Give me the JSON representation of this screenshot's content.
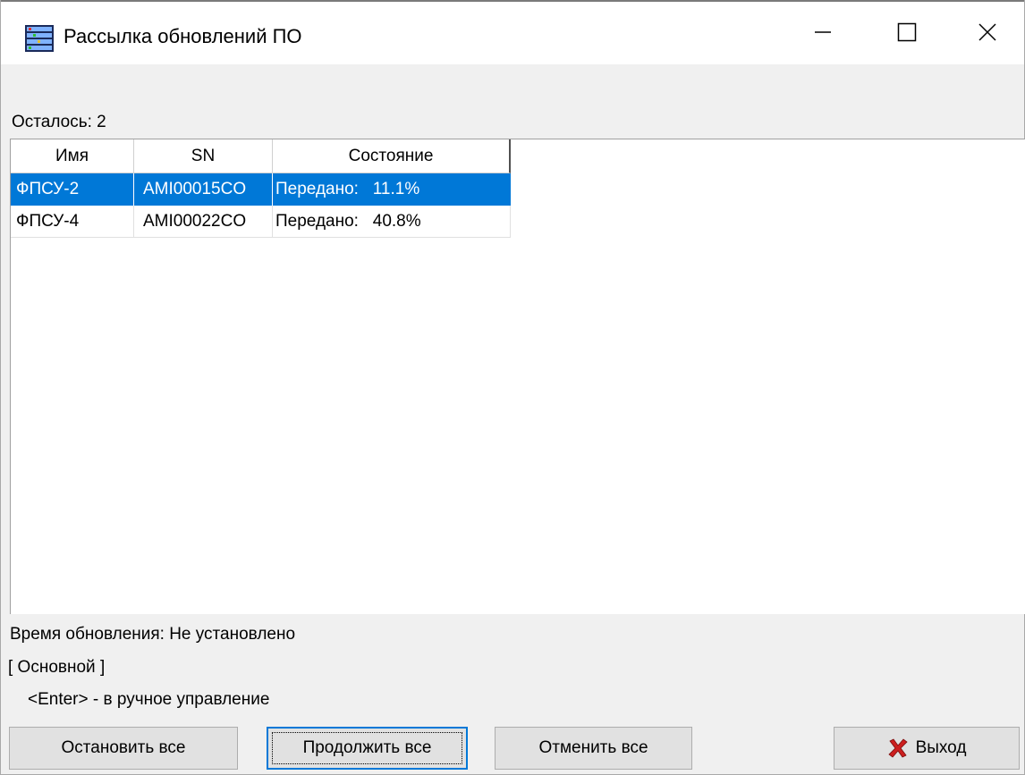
{
  "window": {
    "title": "Рассылка обновлений ПО",
    "icon": "server-rack-icon",
    "controls": [
      "minimize-icon",
      "maximize-icon",
      "close-icon"
    ]
  },
  "remaining": "Осталось: 2",
  "table": {
    "columns": [
      "Имя",
      "SN",
      "Состояние"
    ],
    "rows": [
      {
        "name": "ФПСУ-2",
        "sn": "AMI00015CO",
        "status": "Передано:   11.1%",
        "selected": true
      },
      {
        "name": "ФПСУ-4",
        "sn": "AMI00022CO",
        "status": "Передано:   40.8%",
        "selected": false
      }
    ]
  },
  "status": {
    "update_time": "Время обновления: Не установлено",
    "mode": "[ Основной ]",
    "hint": "<Enter> - в ручное управление"
  },
  "buttons": {
    "stop_all": "Остановить все",
    "continue_all": "Продолжить все",
    "cancel_all": "Отменить все",
    "exit": "Выход",
    "exit_icon": "red-x-icon"
  },
  "colors": {
    "selection": "#0078d7",
    "exit_icon": "#cc1f1f"
  }
}
